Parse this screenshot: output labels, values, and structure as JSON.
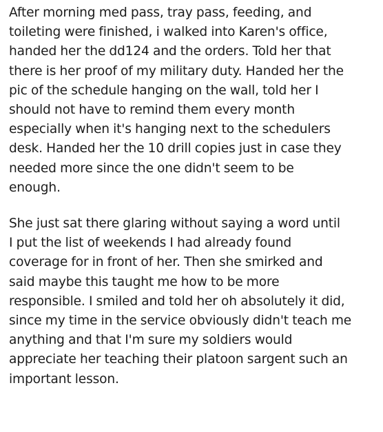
{
  "post": {
    "paragraphs": [
      "After morning med pass, tray pass, feeding, and\ntoileting were finished, i walked into Karen's office,\nhanded her the dd124 and the orders. Told her that\nthere is her proof of my military duty. Handed her the\npic of the schedule hanging on the wall, told her I\nshould not have to remind them every month\nespecially when it's hanging next to the schedulers\ndesk. Handed her the 10 drill copies just in case they\nneeded more since the one didn't seem to be\nenough.",
      "She just sat there glaring without saying a word until\nI put the list of weekends I had already found\ncoverage for in front of her. Then she smirked and\nsaid maybe this taught me how to be more\nresponsible. I smiled and told her oh absolutely it did,\nsince my time in the service obviously didn't teach me\nanything and that I'm sure my soldiers would\nappreciate her teaching their platoon sargent such an\nimportant lesson."
    ]
  }
}
